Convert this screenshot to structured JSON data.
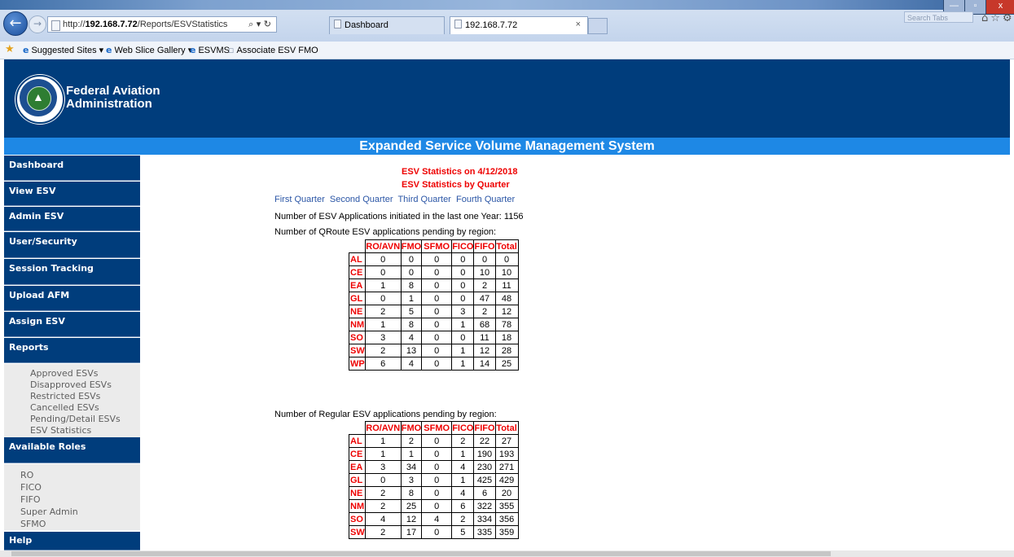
{
  "browser": {
    "url_prefix": "http://",
    "url_host": "192.168.7.72",
    "url_path": "/Reports/ESVStatistics",
    "address_controls": "⌕ ▾ ↻",
    "tabs": [
      {
        "label": "Dashboard"
      },
      {
        "label": "192.168.7.72",
        "close": "×"
      }
    ],
    "window_buttons": [
      "—",
      "▫",
      "x"
    ],
    "search_placeholder": "Search Tabs",
    "toolbar_icons": "⌂☆⚙"
  },
  "favorites": [
    {
      "label": "Suggested Sites ▾"
    },
    {
      "label": "Web Slice Gallery ▾"
    },
    {
      "label": "ESVMS"
    },
    {
      "label": "Associate ESV FMO"
    }
  ],
  "header": {
    "org_line1": "Federal Aviation",
    "org_line2": "Administration",
    "system_title": "Expanded Service Volume Management System"
  },
  "sidebar": {
    "nav": [
      {
        "label": "Dashboard"
      },
      {
        "label": "View ESV"
      },
      {
        "label": "Admin ESV"
      },
      {
        "label": "User/Security"
      },
      {
        "label": "Session Tracking"
      },
      {
        "label": "Upload AFM"
      },
      {
        "label": "Assign ESV"
      },
      {
        "label": "Reports"
      }
    ],
    "reports_items": [
      "Approved ESVs",
      "Disapproved ESVs",
      "Restricted ESVs",
      "Cancelled ESVs",
      "Pending/Detail ESVs",
      "ESV Statistics"
    ],
    "roles_heading": "Available Roles",
    "roles_items": [
      "RO",
      "FICO",
      "FIFO",
      "Super Admin",
      "SFMO"
    ],
    "help": "Help"
  },
  "main": {
    "stats_title": "ESV Statistics on 4/12/2018",
    "stats_subtitle": "ESV Statistics by Quarter",
    "quarters": [
      "First Quarter",
      "Second Quarter",
      "Third Quarter",
      "Fourth Quarter"
    ],
    "initiated_text": "Number of ESV Applications initiated in the last one Year: 1156",
    "qroute_heading": "Number of QRoute ESV applications pending by region:",
    "regular_heading": "Number of Regular ESV applications pending by region:",
    "columns": [
      "RO/AVN",
      "FMO",
      "SFMO",
      "FICO",
      "FIFO",
      "Total"
    ],
    "qroute_rows": [
      {
        "region": "AL",
        "values": [
          "0",
          "0",
          "0",
          "0",
          "0",
          "0"
        ]
      },
      {
        "region": "CE",
        "values": [
          "0",
          "0",
          "0",
          "0",
          "10",
          "10"
        ]
      },
      {
        "region": "EA",
        "values": [
          "1",
          "8",
          "0",
          "0",
          "2",
          "11"
        ]
      },
      {
        "region": "GL",
        "values": [
          "0",
          "1",
          "0",
          "0",
          "47",
          "48"
        ]
      },
      {
        "region": "NE",
        "values": [
          "2",
          "5",
          "0",
          "3",
          "2",
          "12"
        ]
      },
      {
        "region": "NM",
        "values": [
          "1",
          "8",
          "0",
          "1",
          "68",
          "78"
        ]
      },
      {
        "region": "SO",
        "values": [
          "3",
          "4",
          "0",
          "0",
          "11",
          "18"
        ]
      },
      {
        "region": "SW",
        "values": [
          "2",
          "13",
          "0",
          "1",
          "12",
          "28"
        ]
      },
      {
        "region": "WP",
        "values": [
          "6",
          "4",
          "0",
          "1",
          "14",
          "25"
        ]
      }
    ],
    "regular_rows": [
      {
        "region": "AL",
        "values": [
          "1",
          "2",
          "0",
          "2",
          "22",
          "27"
        ]
      },
      {
        "region": "CE",
        "values": [
          "1",
          "1",
          "0",
          "1",
          "190",
          "193"
        ]
      },
      {
        "region": "EA",
        "values": [
          "3",
          "34",
          "0",
          "4",
          "230",
          "271"
        ]
      },
      {
        "region": "GL",
        "values": [
          "0",
          "3",
          "0",
          "1",
          "425",
          "429"
        ]
      },
      {
        "region": "NE",
        "values": [
          "2",
          "8",
          "0",
          "4",
          "6",
          "20"
        ]
      },
      {
        "region": "NM",
        "values": [
          "2",
          "25",
          "0",
          "6",
          "322",
          "355"
        ]
      },
      {
        "region": "SO",
        "values": [
          "4",
          "12",
          "4",
          "2",
          "334",
          "356"
        ]
      },
      {
        "region": "SW",
        "values": [
          "2",
          "17",
          "0",
          "5",
          "335",
          "359"
        ]
      }
    ]
  }
}
